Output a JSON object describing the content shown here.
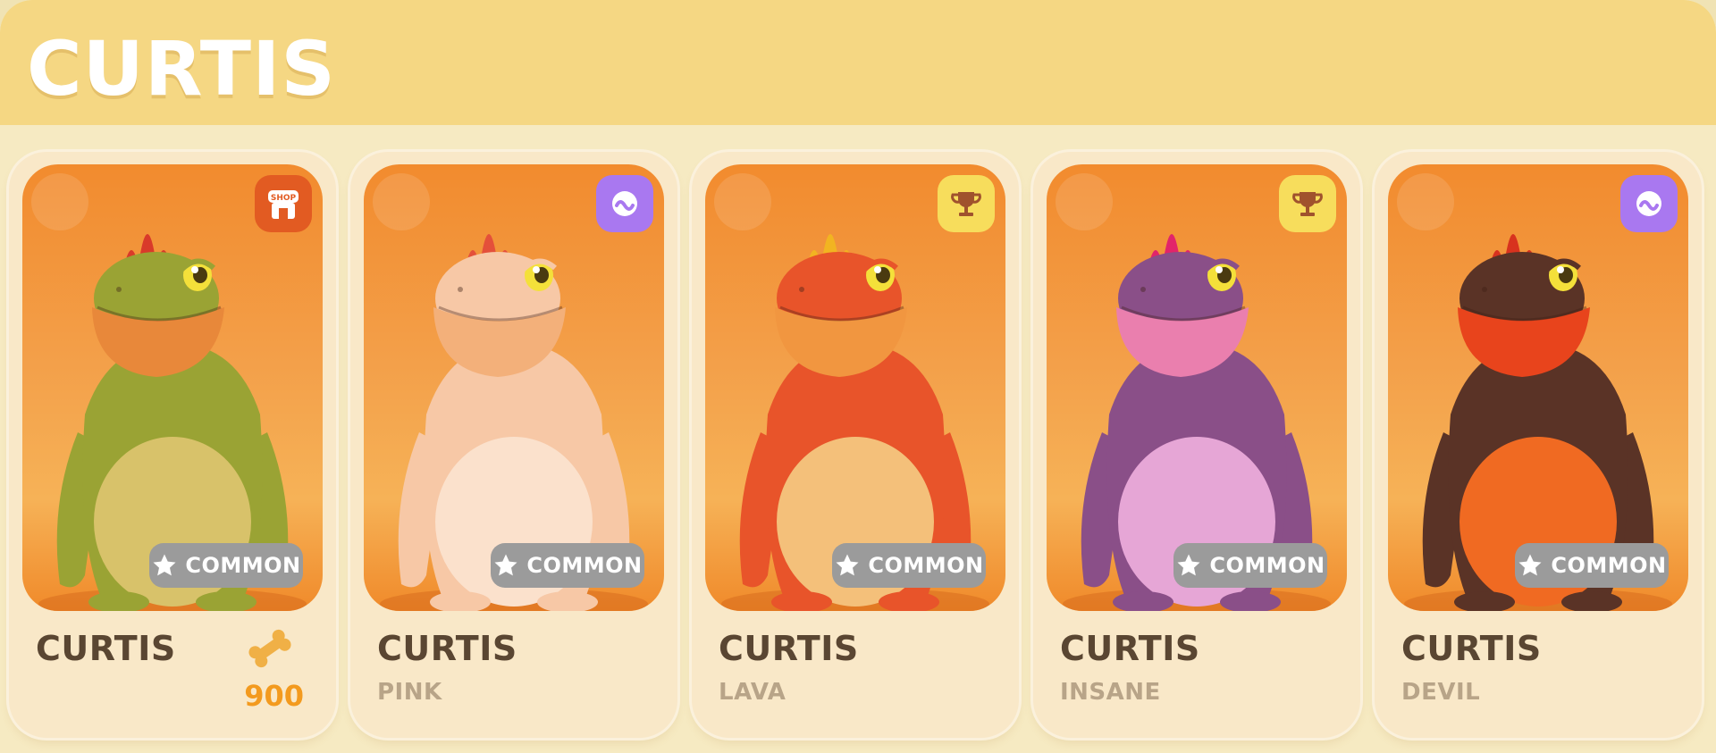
{
  "header": {
    "title": "CURTIS"
  },
  "cards": [
    {
      "name": "CURTIS",
      "variant": "",
      "rarity": "COMMON",
      "badge": "shop-icon",
      "badge_text": "SHOP",
      "price": "900",
      "currency_icon": "bone-icon",
      "colors": {
        "body": "#9aa334",
        "belly": "#d8c26a",
        "crest": "#d93a2a",
        "throat": "#e8883a"
      }
    },
    {
      "name": "CURTIS",
      "variant": "PINK",
      "rarity": "COMMON",
      "badge": "pass-icon",
      "colors": {
        "body": "#f7c8a6",
        "belly": "#fbe1cc",
        "crest": "#e4503a",
        "throat": "#f3b07a"
      }
    },
    {
      "name": "CURTIS",
      "variant": "LAVA",
      "rarity": "COMMON",
      "badge": "trophy-icon",
      "colors": {
        "body": "#e8542a",
        "belly": "#f4c07a",
        "crest": "#f2b421",
        "throat": "#f19640"
      }
    },
    {
      "name": "CURTIS",
      "variant": "INSANE",
      "rarity": "COMMON",
      "badge": "trophy-icon",
      "colors": {
        "body": "#8a4f88",
        "belly": "#e6a6d6",
        "crest": "#e2246a",
        "throat": "#ea7fae"
      }
    },
    {
      "name": "CURTIS",
      "variant": "DEVIL",
      "rarity": "COMMON",
      "badge": "pass-icon",
      "colors": {
        "body": "#5a3326",
        "belly": "#f06a22",
        "crest": "#d8321e",
        "throat": "#e8441c"
      }
    }
  ]
}
